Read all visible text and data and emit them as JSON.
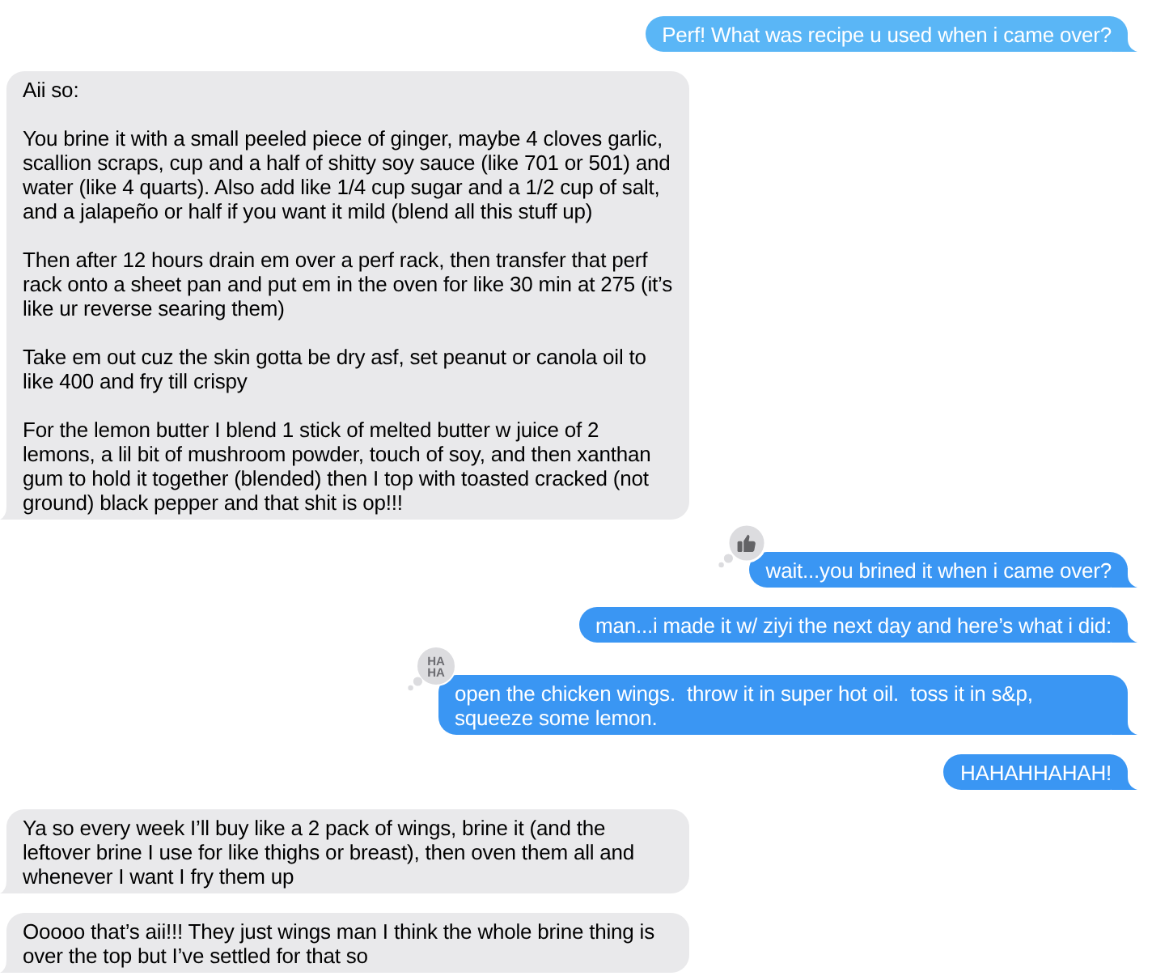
{
  "messages": [
    {
      "kind": "sent",
      "color": "#5ab6f6",
      "text": "Perf! What was recipe u used when i came over?"
    },
    {
      "kind": "received",
      "color": "#e9e9eb",
      "paragraphs": [
        "Aii so:",
        "You brine it with a small peeled piece of ginger, maybe 4 cloves garlic, scallion scraps, cup and a half of shitty soy sauce (like 701 or 501) and water (like 4 quarts). Also add like 1/4 cup sugar and a 1/2 cup of salt, and a jalapeño or half if you want it mild (blend all this stuff up)",
        "Then after 12 hours drain em over a perf rack, then transfer that perf rack onto a sheet pan and put em in the oven for like 30 min at 275 (it’s like ur reverse searing them)",
        "Take em out cuz the skin gotta be dry asf, set peanut or canola oil to like 400 and fry till crispy",
        "For the lemon butter I blend 1 stick of melted butter w juice of 2 lemons, a lil bit of mushroom powder, touch of soy, and then xanthan gum to hold it together (blended) then I top with toasted cracked (not ground) black pepper and that shit is op!!!"
      ]
    },
    {
      "kind": "sent",
      "color": "#3a96f3",
      "text": "wait...you brined it when i came over?",
      "tapback": {
        "kind": "thumbs_up"
      }
    },
    {
      "kind": "sent",
      "color": "#3a96f3",
      "text": "man...i made it w/ ziyi the next day and here’s what i did:"
    },
    {
      "kind": "sent",
      "color": "#3a96f3",
      "text": "open the chicken wings.  throw it in super hot oil.  toss it in s&p, squeeze some lemon.",
      "tapback": {
        "kind": "haha",
        "text": "HA HA"
      }
    },
    {
      "kind": "sent",
      "color": "#3a96f3",
      "text": "HAHAHHAHAH!"
    },
    {
      "kind": "received",
      "color": "#e9e9eb",
      "text": "Ya so every week I’ll buy like a 2 pack of wings, brine it (and the leftover brine I use for like thighs or breast), then oven them all and whenever I want I fry them up"
    },
    {
      "kind": "received",
      "color": "#e9e9eb",
      "text": "Ooooo that’s aii!!! They just wings man I think the whole brine thing is over the top but I’ve settled for that so"
    }
  ]
}
